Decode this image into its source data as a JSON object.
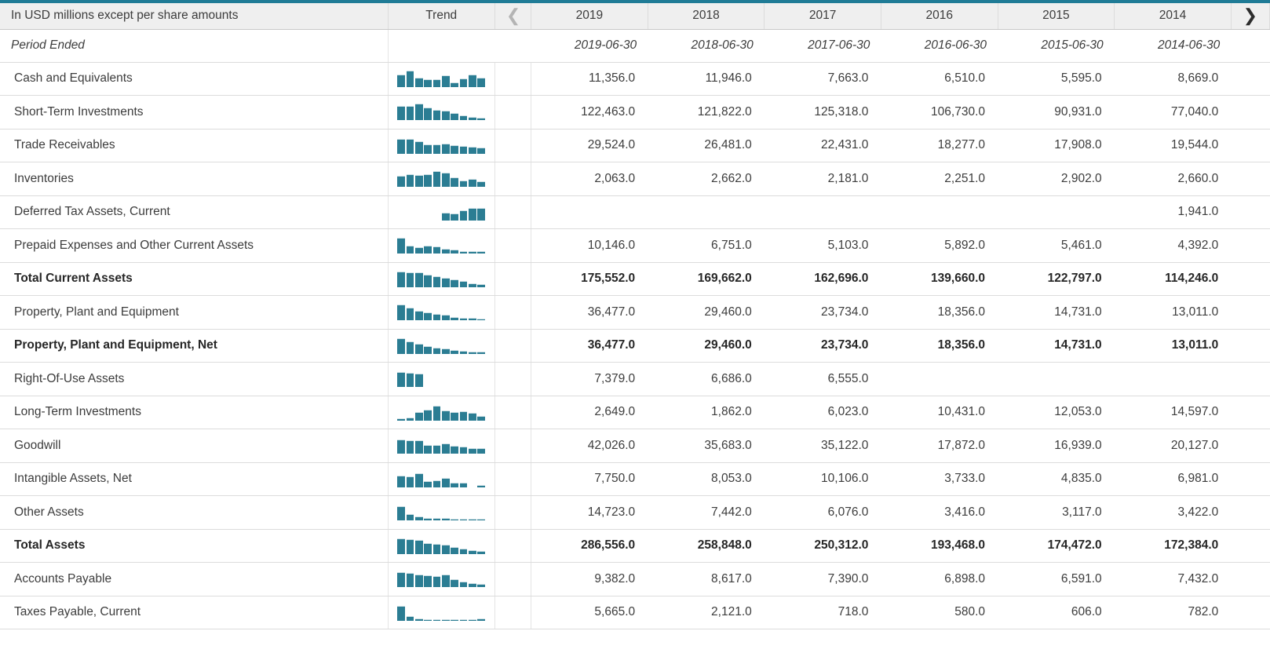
{
  "header": {
    "label_col": "In USD millions except per share amounts",
    "trend_col": "Trend",
    "prev_icon": "chevron-left-icon",
    "next_icon": "chevron-right-icon",
    "years": [
      "2019",
      "2018",
      "2017",
      "2016",
      "2015",
      "2014"
    ]
  },
  "period_row": {
    "label": "Period Ended",
    "values": [
      "2019-06-30",
      "2018-06-30",
      "2017-06-30",
      "2016-06-30",
      "2015-06-30",
      "2014-06-30"
    ]
  },
  "colors": {
    "accent": "#1f7b96",
    "spark_bar": "#2b7d93",
    "header_bg": "#efefef",
    "text": "#3c3c3c",
    "grid_line": "#dcdcdc"
  },
  "rows": [
    {
      "label": "Cash and Equivalents",
      "bold": false,
      "values": [
        "11,356.0",
        "11,946.0",
        "7,663.0",
        "6,510.0",
        "5,595.0",
        "8,669.0"
      ],
      "trend": [
        62,
        78,
        47,
        38,
        36,
        55,
        22,
        40,
        60,
        44
      ]
    },
    {
      "label": "Short-Term Investments",
      "bold": false,
      "values": [
        "122,463.0",
        "121,822.0",
        "125,318.0",
        "106,730.0",
        "90,931.0",
        "77,040.0"
      ],
      "trend": [
        72,
        72,
        80,
        62,
        50,
        46,
        34,
        24,
        16,
        12
      ]
    },
    {
      "label": "Trade Receivables",
      "bold": false,
      "values": [
        "29,524.0",
        "26,481.0",
        "22,431.0",
        "18,277.0",
        "17,908.0",
        "19,544.0"
      ],
      "trend": [
        74,
        72,
        60,
        46,
        46,
        50,
        42,
        38,
        34,
        30
      ]
    },
    {
      "label": "Inventories",
      "bold": false,
      "values": [
        "2,063.0",
        "2,662.0",
        "2,181.0",
        "2,251.0",
        "2,902.0",
        "2,660.0"
      ],
      "trend": [
        54,
        64,
        58,
        62,
        76,
        72,
        46,
        30,
        38,
        26
      ]
    },
    {
      "label": "Deferred Tax Assets, Current",
      "bold": false,
      "values": [
        "",
        "",
        "",
        "",
        "",
        "1,941.0"
      ],
      "trend": [
        0,
        0,
        0,
        0,
        0,
        38,
        32,
        48,
        62,
        60
      ]
    },
    {
      "label": "Prepaid Expenses and Other Current Assets",
      "bold": false,
      "values": [
        "10,146.0",
        "6,751.0",
        "5,103.0",
        "5,892.0",
        "5,461.0",
        "4,392.0"
      ],
      "trend": [
        76,
        40,
        32,
        38,
        34,
        24,
        20,
        14,
        14,
        12
      ]
    },
    {
      "label": "Total Current Assets",
      "bold": true,
      "values": [
        "175,552.0",
        "169,662.0",
        "162,696.0",
        "139,660.0",
        "122,797.0",
        "114,246.0"
      ],
      "trend": [
        76,
        74,
        72,
        60,
        52,
        46,
        36,
        28,
        20,
        16
      ]
    },
    {
      "label": "Property, Plant and Equipment",
      "bold": false,
      "values": [
        "36,477.0",
        "29,460.0",
        "23,734.0",
        "18,356.0",
        "14,731.0",
        "13,011.0"
      ],
      "trend": [
        76,
        62,
        48,
        38,
        30,
        26,
        18,
        14,
        12,
        10
      ]
    },
    {
      "label": "Property, Plant and Equipment, Net",
      "bold": true,
      "values": [
        "36,477.0",
        "29,460.0",
        "23,734.0",
        "18,356.0",
        "14,731.0",
        "13,011.0"
      ],
      "trend": [
        76,
        62,
        48,
        38,
        30,
        26,
        18,
        14,
        12,
        10
      ]
    },
    {
      "label": "Right-Of-Use Assets",
      "bold": false,
      "values": [
        "7,379.0",
        "6,686.0",
        "6,555.0",
        "",
        "",
        ""
      ],
      "trend": [
        74,
        70,
        68,
        0,
        0,
        0,
        0,
        0,
        0,
        0
      ]
    },
    {
      "label": "Long-Term Investments",
      "bold": false,
      "values": [
        "2,649.0",
        "1,862.0",
        "6,023.0",
        "10,431.0",
        "12,053.0",
        "14,597.0"
      ],
      "trend": [
        10,
        14,
        40,
        52,
        72,
        50,
        42,
        46,
        36,
        22
      ]
    },
    {
      "label": "Goodwill",
      "bold": false,
      "values": [
        "42,026.0",
        "35,683.0",
        "35,122.0",
        "17,872.0",
        "16,939.0",
        "20,127.0"
      ],
      "trend": [
        72,
        68,
        66,
        44,
        42,
        50,
        38,
        34,
        28,
        26
      ]
    },
    {
      "label": "Intangible Assets, Net",
      "bold": false,
      "values": [
        "7,750.0",
        "8,053.0",
        "10,106.0",
        "3,733.0",
        "4,835.0",
        "6,981.0"
      ],
      "trend": [
        56,
        54,
        70,
        28,
        34,
        44,
        22,
        22,
        0,
        10
      ]
    },
    {
      "label": "Other Assets",
      "bold": false,
      "values": [
        "14,723.0",
        "7,442.0",
        "6,076.0",
        "3,416.0",
        "3,117.0",
        "3,422.0"
      ],
      "trend": [
        70,
        30,
        22,
        14,
        12,
        12,
        10,
        10,
        10,
        10
      ]
    },
    {
      "label": "Total Assets",
      "bold": true,
      "values": [
        "286,556.0",
        "258,848.0",
        "250,312.0",
        "193,468.0",
        "174,472.0",
        "172,384.0"
      ],
      "trend": [
        76,
        72,
        70,
        54,
        48,
        46,
        34,
        26,
        20,
        16
      ]
    },
    {
      "label": "Accounts Payable",
      "bold": false,
      "values": [
        "9,382.0",
        "8,617.0",
        "7,390.0",
        "6,898.0",
        "6,591.0",
        "7,432.0"
      ],
      "trend": [
        74,
        70,
        62,
        58,
        56,
        62,
        40,
        28,
        22,
        18
      ]
    },
    {
      "label": "Taxes Payable, Current",
      "bold": false,
      "values": [
        "5,665.0",
        "2,121.0",
        "718.0",
        "580.0",
        "606.0",
        "782.0"
      ],
      "trend": [
        74,
        22,
        12,
        8,
        8,
        8,
        8,
        8,
        8,
        12
      ]
    }
  ]
}
